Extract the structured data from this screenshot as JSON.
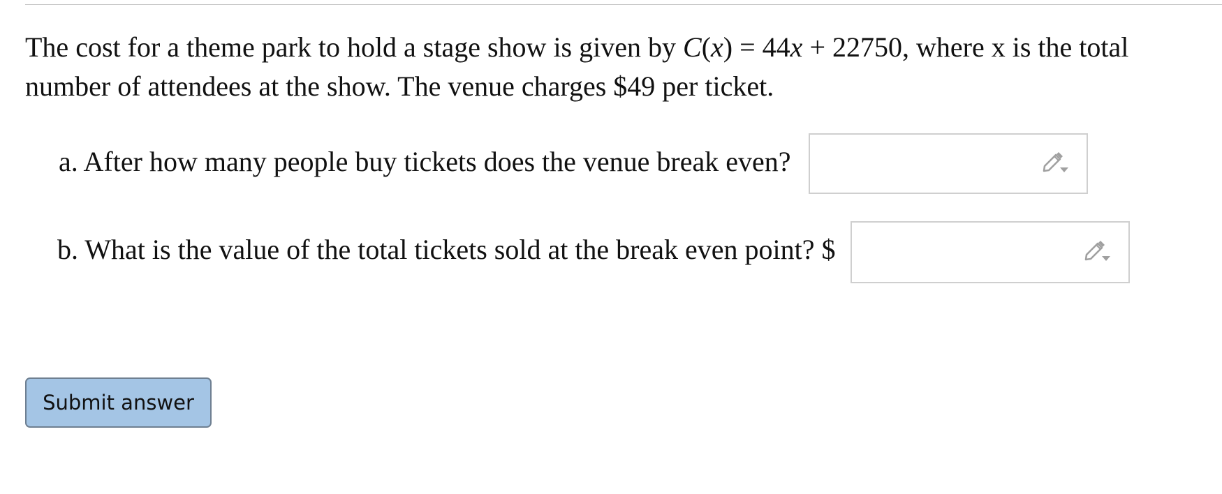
{
  "problem": {
    "intro": "The cost for a theme park to hold a stage show is given by ",
    "function_name": "C",
    "paren_open": "(",
    "variable": "x",
    "paren_close_equals": ") = 44",
    "coefficient_variable": "x",
    "plus_constant": " + 22750",
    "after_formula": ", where ",
    "where_variable": "x",
    "rest": " is the total number of attendees at the show. The venue charges $49 per ticket."
  },
  "part_a": {
    "question": "a. After how many people buy tickets does the venue break even?",
    "answer_value": ""
  },
  "part_b": {
    "question": "b. What is the value of the total tickets sold at the break even point? $",
    "answer_value": ""
  },
  "submit_label": "Submit answer",
  "icons": {
    "answer_edit_icon": "pencil-dropdown-icon"
  },
  "colors": {
    "submit_background": "#a4c5e5",
    "submit_border": "#6e7f91",
    "input_border": "#cfcfcf",
    "icon_color": "#a0a0a0"
  }
}
